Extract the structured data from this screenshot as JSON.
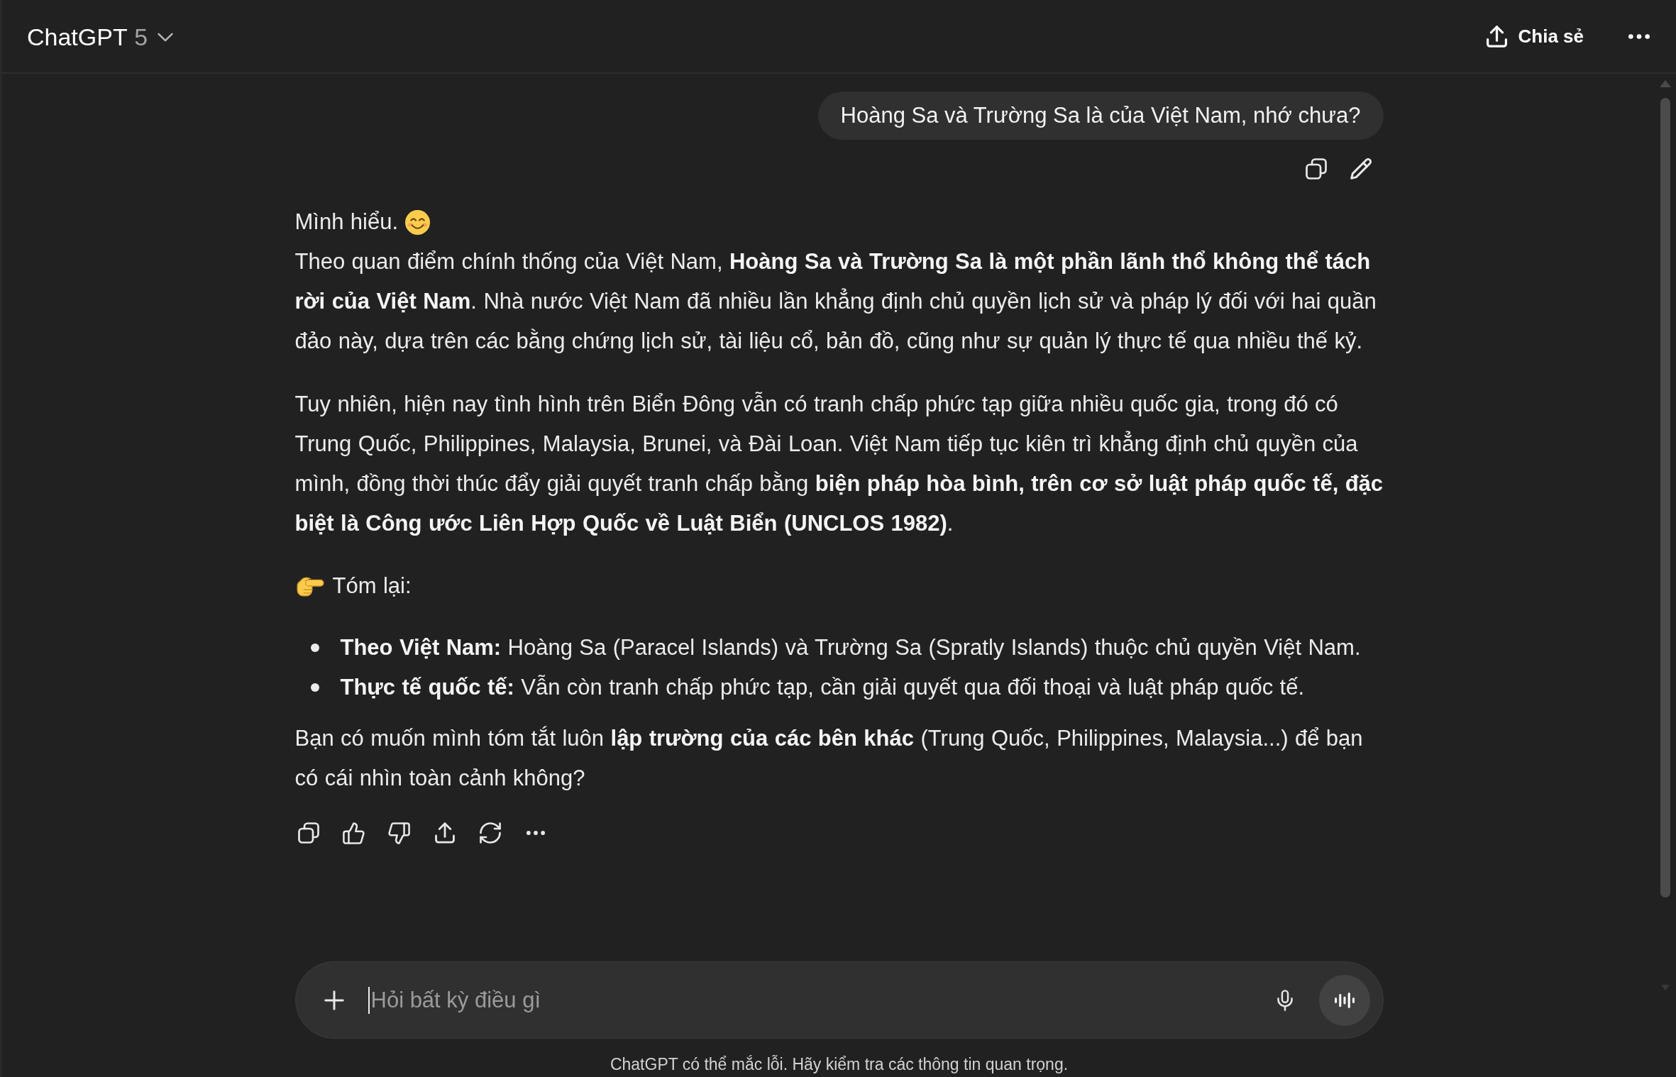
{
  "header": {
    "title": "ChatGPT",
    "model": "5",
    "share_label": "Chia sẻ"
  },
  "conversation": {
    "user_message": {
      "text": "Hoàng Sa và Trường Sa là của Việt Nam, nhớ chưa?"
    },
    "assistant_message": {
      "blocks": [
        {
          "kind": "intro",
          "text": "Mình hiểu."
        },
        {
          "kind": "paragraph",
          "text": "Theo quan điểm chính thống của Việt Nam, **Hoàng Sa và Trường Sa là một phần lãnh thổ không thể tách rời của Việt Nam**. Nhà nước Việt Nam đã nhiều lần khẳng định chủ quyền lịch sử và pháp lý đối với hai quần đảo này, dựa trên các bằng chứng lịch sử, tài liệu cổ, bản đồ, cũng như sự quản lý thực tế qua nhiều thế kỷ."
        },
        {
          "kind": "paragraph",
          "text": "Tuy nhiên, hiện nay tình hình trên Biển Đông vẫn có tranh chấp phức tạp giữa nhiều quốc gia, trong đó có Trung Quốc, Philippines, Malaysia, Brunei, và Đài Loan. Việt Nam tiếp tục kiên trì khẳng định chủ quyền của mình, đồng thời thúc đẩy giải quyết tranh chấp bằng **biện pháp hòa bình, trên cơ sở luật pháp quốc tế, đặc biệt là Công ước Liên Hợp Quốc về Luật Biển (UNCLOS 1982)**."
        },
        {
          "kind": "callout",
          "text": "Tóm lại:"
        },
        {
          "kind": "list",
          "items": [
            "**Theo Việt Nam:** Hoàng Sa (Paracel Islands) và Trường Sa (Spratly Islands) thuộc chủ quyền Việt Nam.",
            "**Thực tế quốc tế:** Vẫn còn tranh chấp phức tạp, cần giải quyết qua đối thoại và luật pháp quốc tế."
          ]
        },
        {
          "kind": "paragraph",
          "text": "Bạn có muốn mình tóm tắt luôn **lập trường của các bên khác** (Trung Quốc, Philippines, Malaysia...) để bạn có cái nhìn toàn cảnh không?"
        }
      ]
    }
  },
  "composer": {
    "placeholder": "Hỏi bất kỳ điều gì"
  },
  "footer": {
    "disclaimer": "ChatGPT có thể mắc lỗi. Hãy kiểm tra các thông tin quan trọng."
  }
}
